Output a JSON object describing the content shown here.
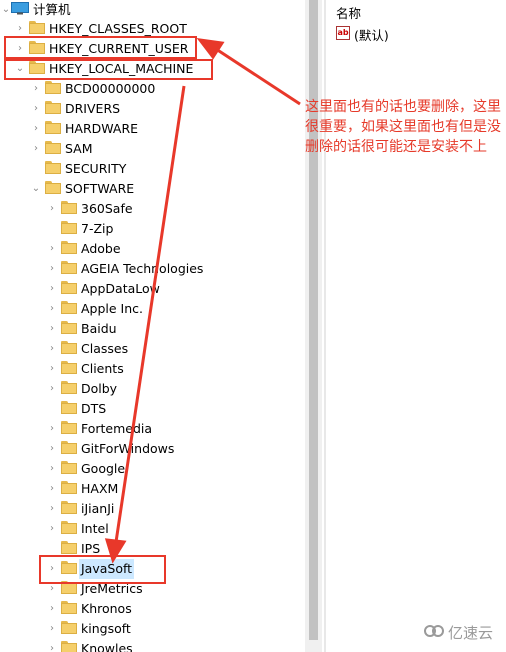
{
  "tree": {
    "root": "计算机",
    "hives": [
      "HKEY_CLASSES_ROOT",
      "HKEY_CURRENT_USER",
      "HKEY_LOCAL_MACHINE"
    ],
    "hklm_children": [
      "BCD00000000",
      "DRIVERS",
      "HARDWARE",
      "SAM",
      "SECURITY",
      "SOFTWARE"
    ],
    "software_children": [
      "360Safe",
      "7-Zip",
      "Adobe",
      "AGEIA Technologies",
      "AppDataLow",
      "Apple Inc.",
      "Baidu",
      "Classes",
      "Clients",
      "Dolby",
      "DTS",
      "Fortemedia",
      "GitForWindows",
      "Google",
      "HAXM",
      "iJianJi",
      "Intel",
      "IPS",
      "JavaSoft",
      "JreMetrics",
      "Khronos",
      "kingsoft",
      "Knowles"
    ],
    "selected": "JavaSoft"
  },
  "values_pane": {
    "column_name": "名称",
    "default_value": "(默认)",
    "icon": "ab-string-icon"
  },
  "annotation": {
    "note": "这里面也有的话也要删除，这里很重要，如果这里面也有但是没删除的话很可能还是安装不上",
    "color": "#e8382a"
  },
  "watermark": {
    "text": "亿速云"
  }
}
